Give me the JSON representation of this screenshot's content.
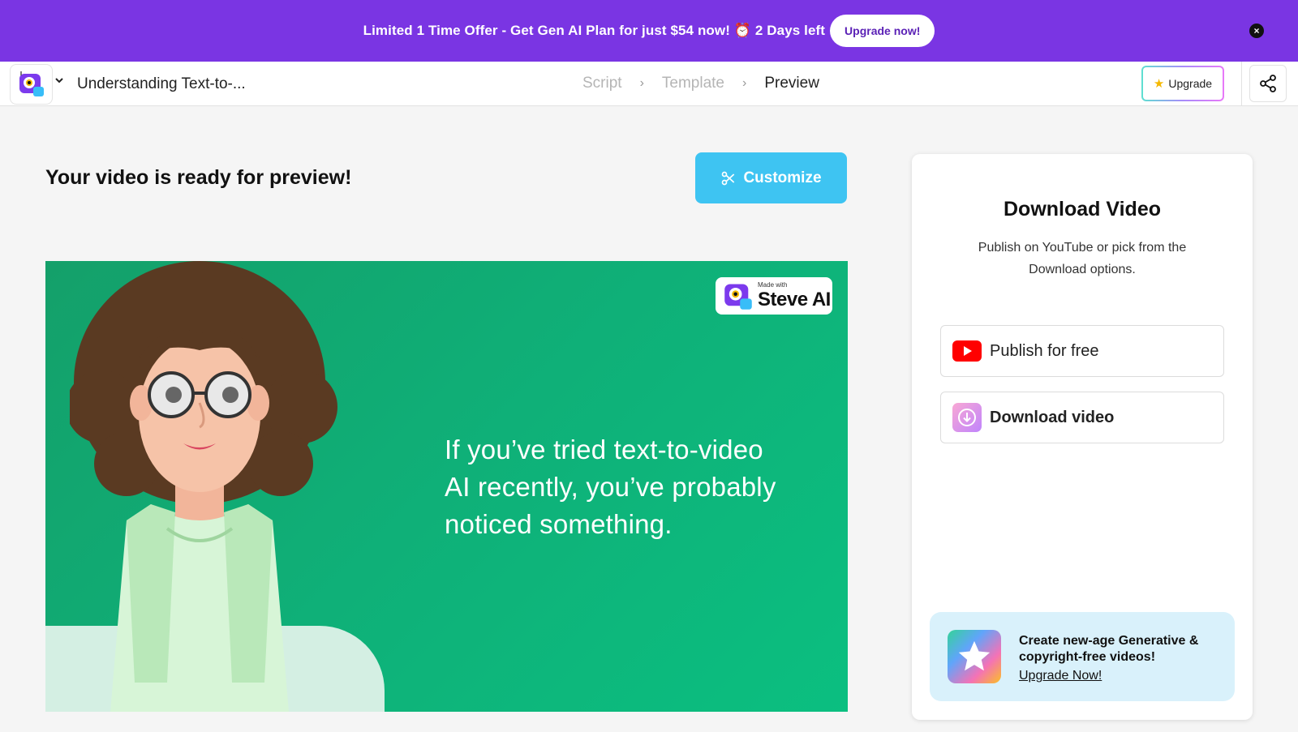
{
  "banner": {
    "text": "Limited 1 Time Offer - Get Gen AI Plan for just $54 now! ⏰ 2 Days left",
    "button_label": "Upgrade now!",
    "close_glyph": "×"
  },
  "header": {
    "project_title": "Understanding Text-to-...",
    "chevron_glyph": "⌄",
    "breadcrumbs": [
      {
        "label": "Script",
        "active": false
      },
      {
        "label": "Template",
        "active": false
      },
      {
        "label": "Preview",
        "active": true
      }
    ],
    "crumb_sep": "›",
    "upgrade_label": "Upgrade",
    "upgrade_star": "★"
  },
  "main": {
    "heading": "Your video is ready for preview!",
    "customize_label": "Customize"
  },
  "video": {
    "caption": "If you’ve tried text-to-video AI recently, you’ve probably noticed something.",
    "watermark_small": "Made with",
    "watermark_brand": "Steve AI"
  },
  "panel": {
    "title": "Download Video",
    "subtitle": "Publish on YouTube or pick from the Download options.",
    "publish_label": "Publish for free",
    "download_label": "Download video",
    "promo_text": "Create new-age Generative & copyright-free videos!",
    "promo_link": "Upgrade Now!"
  },
  "colors": {
    "banner_bg": "#7a35e3",
    "customize_bg": "#3ec4f2",
    "video_bg": "#0fb078",
    "promo_card_bg": "#d9f1fb",
    "youtube_red": "#ff0000"
  },
  "icons": [
    "close-icon",
    "app-logo-icon",
    "chevron-down-icon",
    "star-icon",
    "share-icon",
    "scissors-icon",
    "youtube-icon",
    "download-icon"
  ]
}
